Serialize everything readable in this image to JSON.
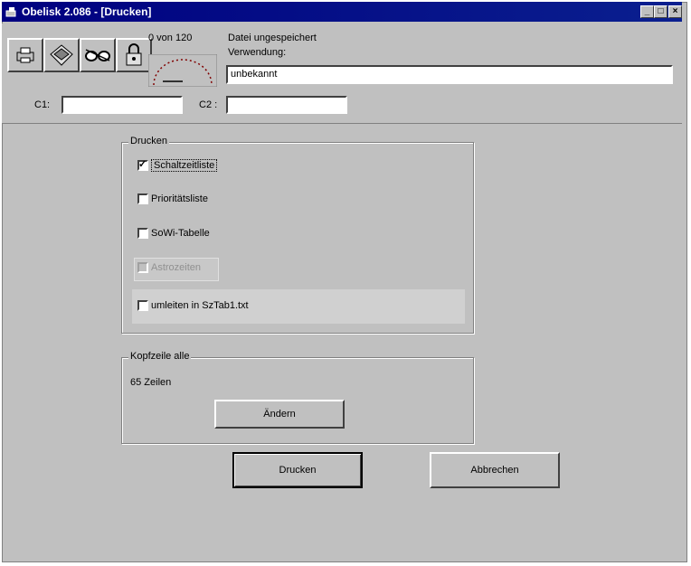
{
  "window": {
    "title": "Obelisk 2.086 - [Drucken]"
  },
  "titlebar_buttons": [
    "_",
    "□",
    "×"
  ],
  "toolbar": {
    "counter_text": "0 von 120",
    "status": "Datei ungespeichert",
    "verwendung_label": "Verwendung:",
    "verwendung_value": "unbekannt",
    "c1_label": "C1:",
    "c1_value": "",
    "c2_label": "C2 :",
    "c2_value": ""
  },
  "drucken_group": {
    "title": "Drucken",
    "options": [
      {
        "label": "Schaltzeitliste",
        "checked": true,
        "enabled": true
      },
      {
        "label": "Prioritätsliste",
        "checked": false,
        "enabled": true
      },
      {
        "label": "SoWi-Tabelle",
        "checked": false,
        "enabled": true
      },
      {
        "label": "Astrozeiten",
        "checked": false,
        "enabled": false
      },
      {
        "label": "umleiten in SzTab1.txt",
        "checked": false,
        "enabled": true
      }
    ]
  },
  "kopfzeile_group": {
    "title": "Kopfzeile alle",
    "lines_text": "65 Zeilen",
    "change_button": "Ändern"
  },
  "actions": {
    "print_button": "Drucken",
    "cancel_button": "Abbrechen"
  }
}
